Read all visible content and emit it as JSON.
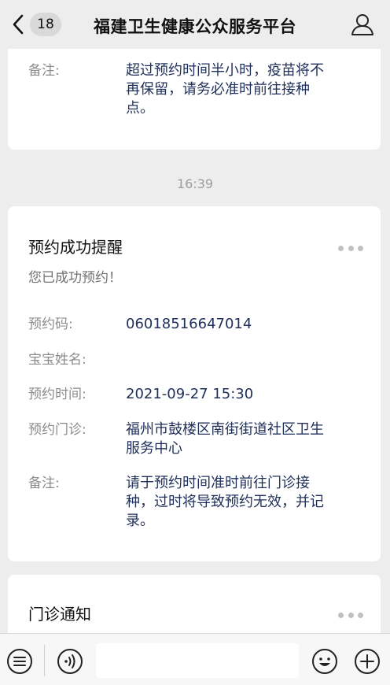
{
  "header": {
    "back_badge": "18",
    "title": "福建卫生健康公众服务平台",
    "back_icon": "chevron-left-icon",
    "profile_icon": "user-icon"
  },
  "prev_card": {
    "note_label": "备注:",
    "note_lines": [
      "超过预约时间半小时，疫苗将不",
      "再保留，请务必准时前往接种",
      "点。"
    ]
  },
  "timestamp": "16:39",
  "appointment_card": {
    "title": "预约成功提醒",
    "subtitle": "您已成功预约！",
    "fields": [
      {
        "label": "预约码:",
        "value_lines": [
          "06018516647014"
        ]
      },
      {
        "label": "宝宝姓名:",
        "value_lines": []
      },
      {
        "label": "预约时间:",
        "value_lines": [
          "2021-09-27 15:30"
        ]
      },
      {
        "label": "预约门诊:",
        "value_lines": [
          "福州市鼓楼区南街街道社区卫生",
          "服务中心"
        ]
      },
      {
        "label": "备注:",
        "value_lines": [
          "请于预约时间准时前往门诊接",
          "种，过时将导致预约无效，并记",
          "录。"
        ]
      }
    ]
  },
  "next_card": {
    "title": "门诊通知"
  },
  "bottom_bar": {
    "menu_icon": "menu-list-icon",
    "voice_icon": "voice-icon",
    "emoji_icon": "emoji-icon",
    "add_icon": "plus-circle-icon"
  }
}
